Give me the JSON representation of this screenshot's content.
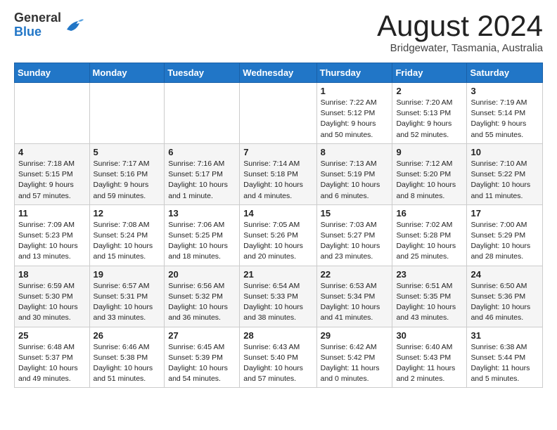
{
  "header": {
    "logo_general": "General",
    "logo_blue": "Blue",
    "month_title": "August 2024",
    "subtitle": "Bridgewater, Tasmania, Australia"
  },
  "days_of_week": [
    "Sunday",
    "Monday",
    "Tuesday",
    "Wednesday",
    "Thursday",
    "Friday",
    "Saturday"
  ],
  "weeks": [
    [
      {
        "day": "",
        "info": ""
      },
      {
        "day": "",
        "info": ""
      },
      {
        "day": "",
        "info": ""
      },
      {
        "day": "",
        "info": ""
      },
      {
        "day": "1",
        "info": "Sunrise: 7:22 AM\nSunset: 5:12 PM\nDaylight: 9 hours\nand 50 minutes."
      },
      {
        "day": "2",
        "info": "Sunrise: 7:20 AM\nSunset: 5:13 PM\nDaylight: 9 hours\nand 52 minutes."
      },
      {
        "day": "3",
        "info": "Sunrise: 7:19 AM\nSunset: 5:14 PM\nDaylight: 9 hours\nand 55 minutes."
      }
    ],
    [
      {
        "day": "4",
        "info": "Sunrise: 7:18 AM\nSunset: 5:15 PM\nDaylight: 9 hours\nand 57 minutes."
      },
      {
        "day": "5",
        "info": "Sunrise: 7:17 AM\nSunset: 5:16 PM\nDaylight: 9 hours\nand 59 minutes."
      },
      {
        "day": "6",
        "info": "Sunrise: 7:16 AM\nSunset: 5:17 PM\nDaylight: 10 hours\nand 1 minute."
      },
      {
        "day": "7",
        "info": "Sunrise: 7:14 AM\nSunset: 5:18 PM\nDaylight: 10 hours\nand 4 minutes."
      },
      {
        "day": "8",
        "info": "Sunrise: 7:13 AM\nSunset: 5:19 PM\nDaylight: 10 hours\nand 6 minutes."
      },
      {
        "day": "9",
        "info": "Sunrise: 7:12 AM\nSunset: 5:20 PM\nDaylight: 10 hours\nand 8 minutes."
      },
      {
        "day": "10",
        "info": "Sunrise: 7:10 AM\nSunset: 5:22 PM\nDaylight: 10 hours\nand 11 minutes."
      }
    ],
    [
      {
        "day": "11",
        "info": "Sunrise: 7:09 AM\nSunset: 5:23 PM\nDaylight: 10 hours\nand 13 minutes."
      },
      {
        "day": "12",
        "info": "Sunrise: 7:08 AM\nSunset: 5:24 PM\nDaylight: 10 hours\nand 15 minutes."
      },
      {
        "day": "13",
        "info": "Sunrise: 7:06 AM\nSunset: 5:25 PM\nDaylight: 10 hours\nand 18 minutes."
      },
      {
        "day": "14",
        "info": "Sunrise: 7:05 AM\nSunset: 5:26 PM\nDaylight: 10 hours\nand 20 minutes."
      },
      {
        "day": "15",
        "info": "Sunrise: 7:03 AM\nSunset: 5:27 PM\nDaylight: 10 hours\nand 23 minutes."
      },
      {
        "day": "16",
        "info": "Sunrise: 7:02 AM\nSunset: 5:28 PM\nDaylight: 10 hours\nand 25 minutes."
      },
      {
        "day": "17",
        "info": "Sunrise: 7:00 AM\nSunset: 5:29 PM\nDaylight: 10 hours\nand 28 minutes."
      }
    ],
    [
      {
        "day": "18",
        "info": "Sunrise: 6:59 AM\nSunset: 5:30 PM\nDaylight: 10 hours\nand 30 minutes."
      },
      {
        "day": "19",
        "info": "Sunrise: 6:57 AM\nSunset: 5:31 PM\nDaylight: 10 hours\nand 33 minutes."
      },
      {
        "day": "20",
        "info": "Sunrise: 6:56 AM\nSunset: 5:32 PM\nDaylight: 10 hours\nand 36 minutes."
      },
      {
        "day": "21",
        "info": "Sunrise: 6:54 AM\nSunset: 5:33 PM\nDaylight: 10 hours\nand 38 minutes."
      },
      {
        "day": "22",
        "info": "Sunrise: 6:53 AM\nSunset: 5:34 PM\nDaylight: 10 hours\nand 41 minutes."
      },
      {
        "day": "23",
        "info": "Sunrise: 6:51 AM\nSunset: 5:35 PM\nDaylight: 10 hours\nand 43 minutes."
      },
      {
        "day": "24",
        "info": "Sunrise: 6:50 AM\nSunset: 5:36 PM\nDaylight: 10 hours\nand 46 minutes."
      }
    ],
    [
      {
        "day": "25",
        "info": "Sunrise: 6:48 AM\nSunset: 5:37 PM\nDaylight: 10 hours\nand 49 minutes."
      },
      {
        "day": "26",
        "info": "Sunrise: 6:46 AM\nSunset: 5:38 PM\nDaylight: 10 hours\nand 51 minutes."
      },
      {
        "day": "27",
        "info": "Sunrise: 6:45 AM\nSunset: 5:39 PM\nDaylight: 10 hours\nand 54 minutes."
      },
      {
        "day": "28",
        "info": "Sunrise: 6:43 AM\nSunset: 5:40 PM\nDaylight: 10 hours\nand 57 minutes."
      },
      {
        "day": "29",
        "info": "Sunrise: 6:42 AM\nSunset: 5:42 PM\nDaylight: 11 hours\nand 0 minutes."
      },
      {
        "day": "30",
        "info": "Sunrise: 6:40 AM\nSunset: 5:43 PM\nDaylight: 11 hours\nand 2 minutes."
      },
      {
        "day": "31",
        "info": "Sunrise: 6:38 AM\nSunset: 5:44 PM\nDaylight: 11 hours\nand 5 minutes."
      }
    ]
  ]
}
